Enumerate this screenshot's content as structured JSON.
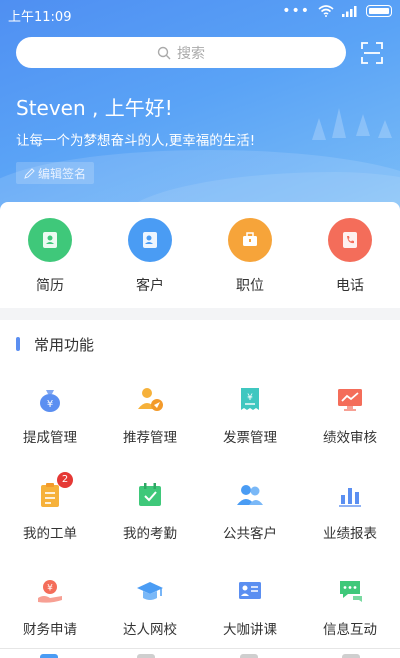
{
  "status_bar": {
    "time": "上午11:09",
    "dots": "•••"
  },
  "search": {
    "placeholder": "搜索"
  },
  "header": {
    "greeting": "Steven , 上午好!",
    "motto": "让每一个为梦想奋斗的人,更幸福的生活!",
    "edit_signature": "编辑签名"
  },
  "quick_actions": [
    {
      "label": "简历",
      "icon": "resume-icon",
      "color": "#3fc87a"
    },
    {
      "label": "客户",
      "icon": "customer-icon",
      "color": "#4a9cf4"
    },
    {
      "label": "职位",
      "icon": "briefcase-icon",
      "color": "#f6a43a"
    },
    {
      "label": "电话",
      "icon": "phone-icon",
      "color": "#f46d5a"
    }
  ],
  "common_functions": {
    "title": "常用功能",
    "items": [
      {
        "label": "提成管理",
        "icon": "money-bag-icon"
      },
      {
        "label": "推荐管理",
        "icon": "recommend-icon"
      },
      {
        "label": "发票管理",
        "icon": "invoice-icon"
      },
      {
        "label": "绩效审核",
        "icon": "performance-chart-icon"
      },
      {
        "label": "我的工单",
        "icon": "work-order-icon",
        "badge": "2"
      },
      {
        "label": "我的考勤",
        "icon": "attendance-icon"
      },
      {
        "label": "公共客户",
        "icon": "public-customers-icon"
      },
      {
        "label": "业绩报表",
        "icon": "bar-chart-icon"
      },
      {
        "label": "财务申请",
        "icon": "finance-icon"
      },
      {
        "label": "达人网校",
        "icon": "graduation-cap-icon"
      },
      {
        "label": "大咖讲课",
        "icon": "lecture-icon"
      },
      {
        "label": "信息互动",
        "icon": "chat-icon"
      }
    ]
  },
  "colors": {
    "accent": "#5b8ff1",
    "hero_start": "#4f8ff2",
    "hero_end": "#7fc0f7",
    "badge": "#e53935"
  }
}
